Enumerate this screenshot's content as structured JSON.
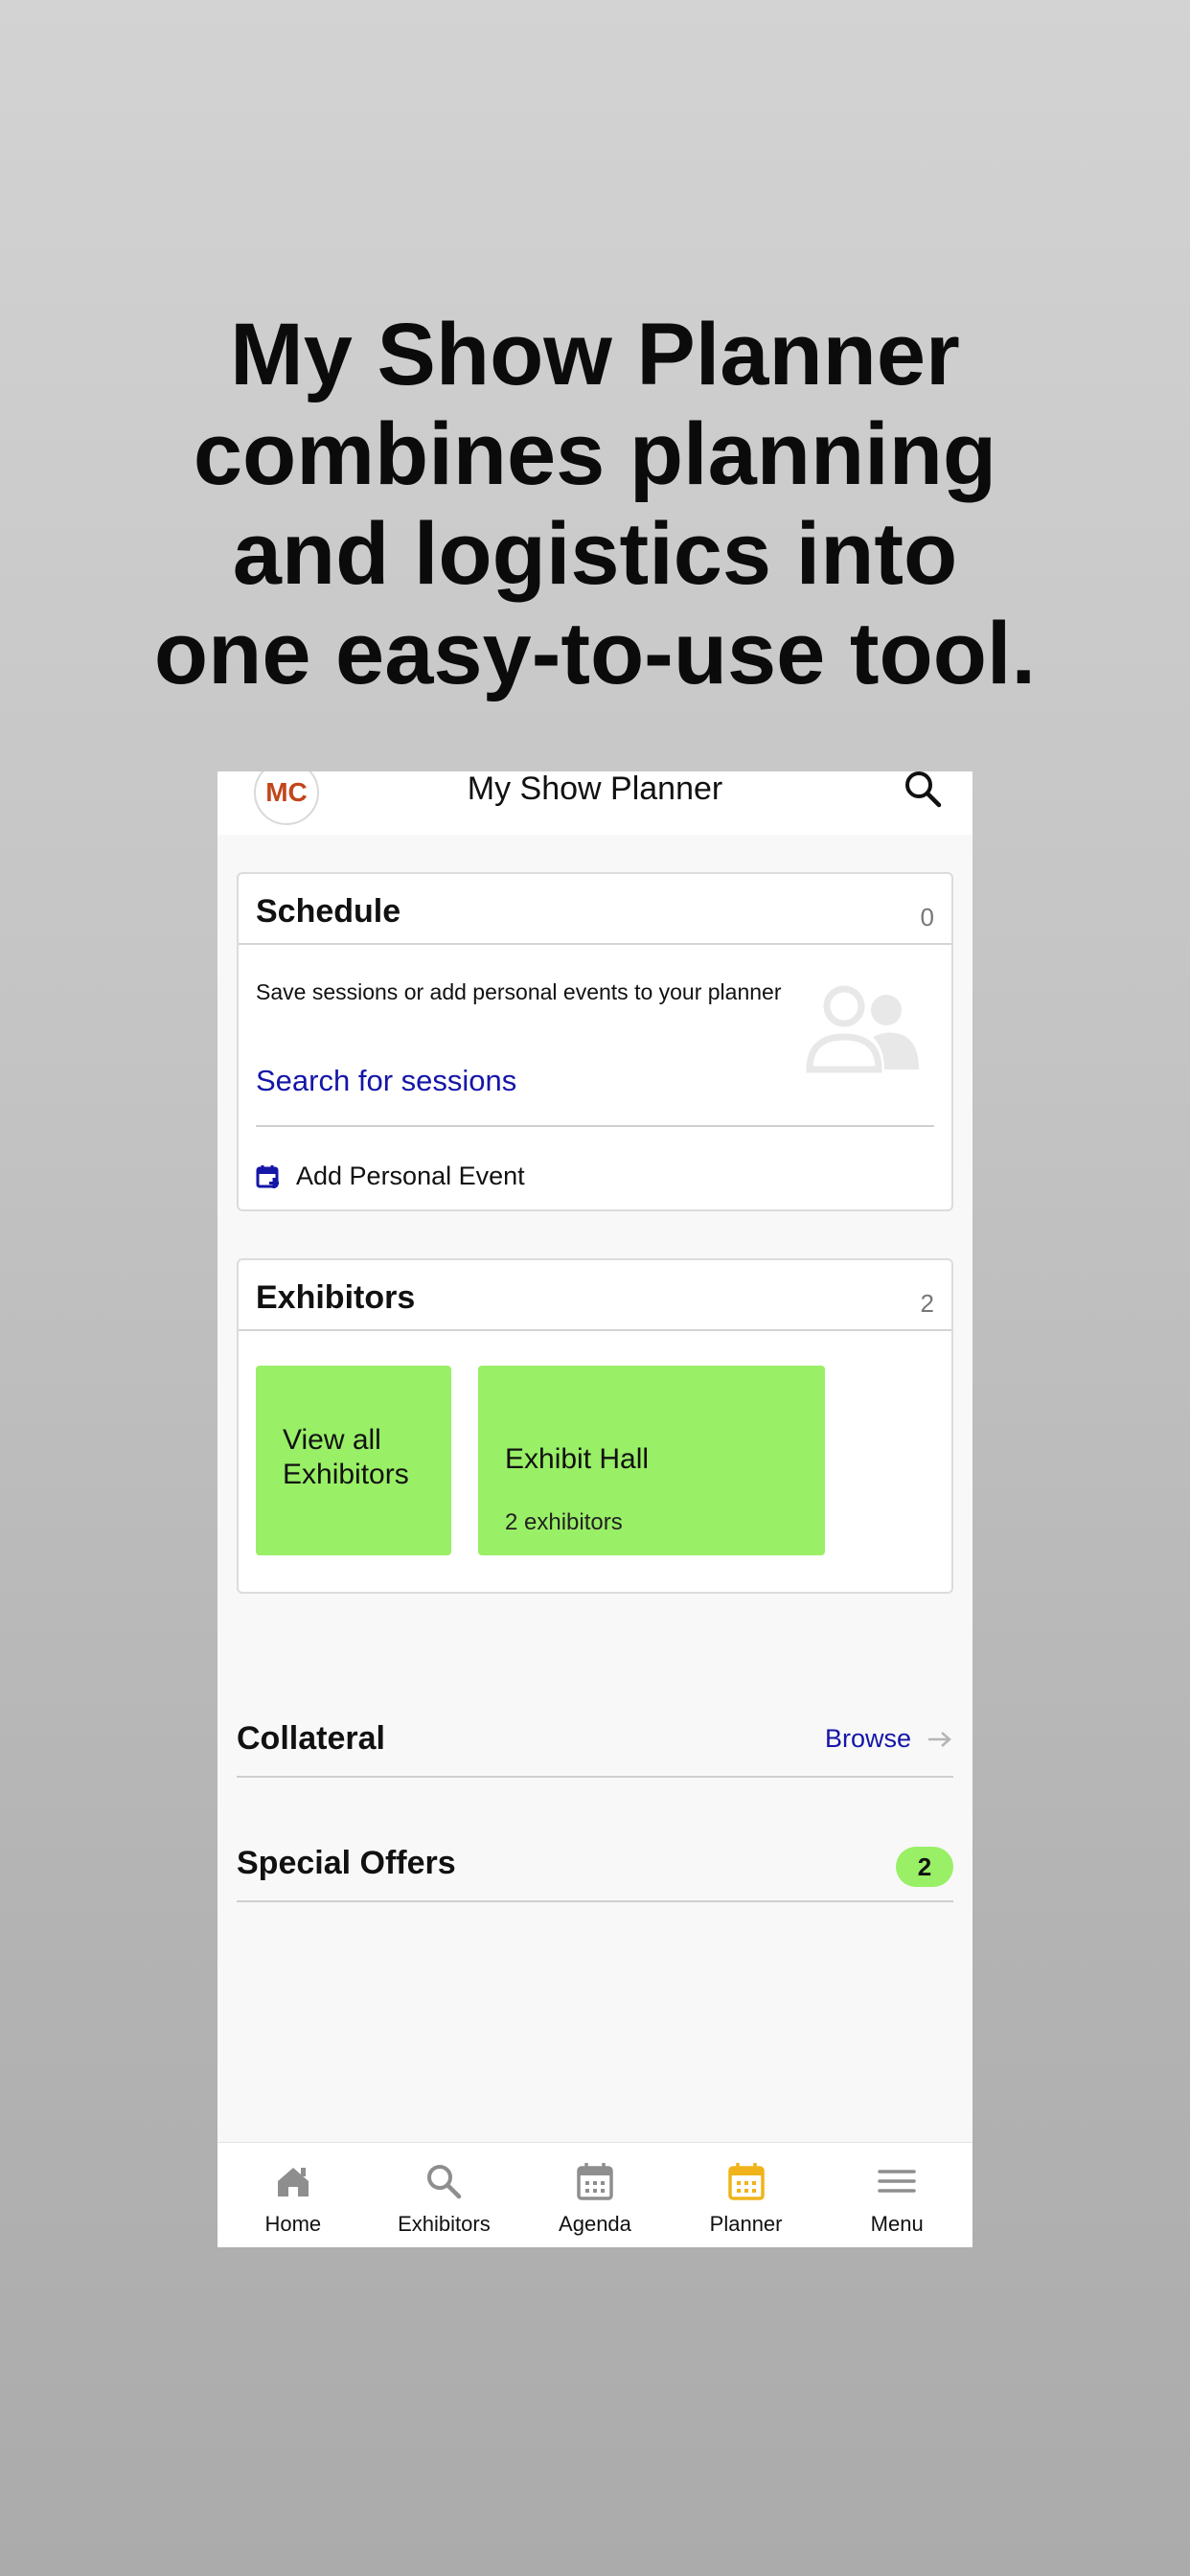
{
  "headline": {
    "line1": "My Show Planner",
    "line2": "combines planning",
    "line3": "and logistics into",
    "line4": "one easy-to-use tool."
  },
  "header": {
    "avatar_initials": "MC",
    "title": "My Show Planner",
    "search_icon": "search-icon"
  },
  "schedule": {
    "title": "Schedule",
    "count": "0",
    "description": "Save sessions or add personal events to your planner",
    "search_link": "Search for sessions",
    "add_event_label": "Add Personal Event",
    "add_event_icon": "calendar-add-icon",
    "empty_icon": "people-icon"
  },
  "exhibitors": {
    "title": "Exhibitors",
    "count": "2",
    "view_all_line1": "View all",
    "view_all_line2": "Exhibitors",
    "hall_name": "Exhibit Hall",
    "hall_count": "2 exhibitors"
  },
  "collateral": {
    "title": "Collateral",
    "browse_label": "Browse"
  },
  "special_offers": {
    "title": "Special Offers",
    "badge": "2"
  },
  "tabs": [
    {
      "label": "Home",
      "icon": "home-icon"
    },
    {
      "label": "Exhibitors",
      "icon": "search-icon"
    },
    {
      "label": "Agenda",
      "icon": "calendar-icon"
    },
    {
      "label": "Planner",
      "icon": "calendar-icon",
      "active": true
    },
    {
      "label": "Menu",
      "icon": "hamburger-icon"
    }
  ],
  "colors": {
    "accent_green": "#99ef66",
    "link_blue": "#1515a8",
    "active_tab": "#f0b31a",
    "inactive_tab": "#8e8e8e",
    "avatar_text": "#c2461c"
  }
}
